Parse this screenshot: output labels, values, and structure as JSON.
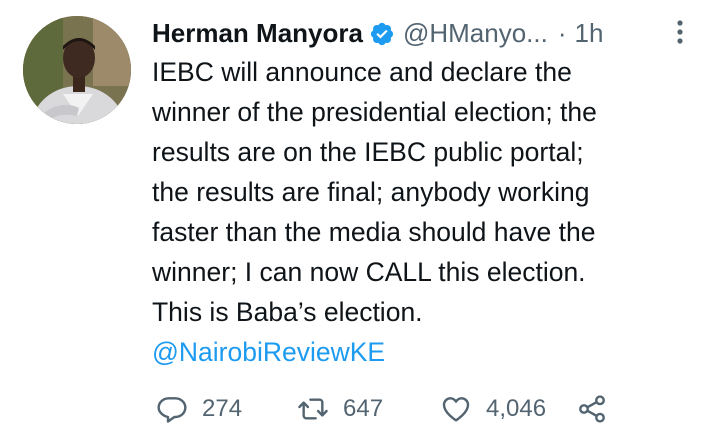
{
  "tweet": {
    "author": {
      "display_name": "Herman Manyora",
      "handle": "@HManyo...",
      "verified": true
    },
    "separator": "·",
    "time": "1h",
    "text_lines": [
      "IEBC will announce and declare the",
      "winner of the presidential election; the",
      "results are on the IEBC public portal;",
      "the results are final; anybody working",
      "faster than the media should have the",
      "winner; I can now CALL this election.",
      "This is Baba’s election."
    ],
    "mention": "@NairobiReviewKE",
    "actions": {
      "reply_count": "274",
      "retweet_count": "647",
      "like_count": "4,046"
    },
    "icons": {
      "verified": "verified-badge-icon",
      "more": "more-vertical-icon",
      "reply": "reply-icon",
      "retweet": "retweet-icon",
      "like": "heart-icon",
      "share": "share-icon"
    },
    "colors": {
      "link": "#1d9bf0",
      "secondary_text": "#536471",
      "primary_text": "#0f1419"
    }
  }
}
